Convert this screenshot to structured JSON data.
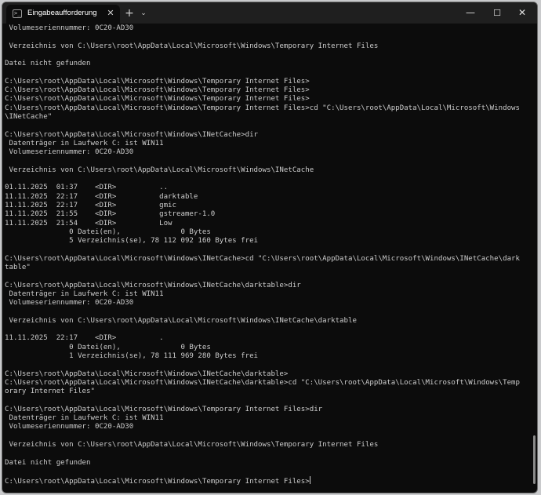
{
  "titlebar": {
    "tab_title": "Eingabeaufforderung",
    "tab_icon": "terminal-icon",
    "tab_close_glyph": "✕",
    "new_tab_glyph": "+",
    "dropdown_glyph": "⌄",
    "minimize_glyph": "—",
    "maximize_glyph": "☐",
    "close_glyph": "✕"
  },
  "console": {
    "lines": [
      " Volumeseriennummer: 0C20-AD30",
      "",
      " Verzeichnis von C:\\Users\\root\\AppData\\Local\\Microsoft\\Windows\\Temporary Internet Files",
      "",
      "Datei nicht gefunden",
      "",
      "C:\\Users\\root\\AppData\\Local\\Microsoft\\Windows\\Temporary Internet Files>",
      "C:\\Users\\root\\AppData\\Local\\Microsoft\\Windows\\Temporary Internet Files>",
      "C:\\Users\\root\\AppData\\Local\\Microsoft\\Windows\\Temporary Internet Files>",
      "C:\\Users\\root\\AppData\\Local\\Microsoft\\Windows\\Temporary Internet Files>cd \"C:\\Users\\root\\AppData\\Local\\Microsoft\\Windows",
      "\\INetCache\"",
      "",
      "C:\\Users\\root\\AppData\\Local\\Microsoft\\Windows\\INetCache>dir",
      " Datenträger in Laufwerk C: ist WIN11",
      " Volumeseriennummer: 0C20-AD30",
      "",
      " Verzeichnis von C:\\Users\\root\\AppData\\Local\\Microsoft\\Windows\\INetCache",
      "",
      "01.11.2025  01:37    <DIR>          ..",
      "11.11.2025  22:17    <DIR>          darktable",
      "11.11.2025  22:17    <DIR>          gmic",
      "11.11.2025  21:55    <DIR>          gstreamer-1.0",
      "11.11.2025  21:54    <DIR>          Low",
      "               0 Datei(en),              0 Bytes",
      "               5 Verzeichnis(se), 78 112 092 160 Bytes frei",
      "",
      "C:\\Users\\root\\AppData\\Local\\Microsoft\\Windows\\INetCache>cd \"C:\\Users\\root\\AppData\\Local\\Microsoft\\Windows\\INetCache\\dark",
      "table\"",
      "",
      "C:\\Users\\root\\AppData\\Local\\Microsoft\\Windows\\INetCache\\darktable>dir",
      " Datenträger in Laufwerk C: ist WIN11",
      " Volumeseriennummer: 0C20-AD30",
      "",
      " Verzeichnis von C:\\Users\\root\\AppData\\Local\\Microsoft\\Windows\\INetCache\\darktable",
      "",
      "11.11.2025  22:17    <DIR>          .",
      "               0 Datei(en),              0 Bytes",
      "               1 Verzeichnis(se), 78 111 969 280 Bytes frei",
      "",
      "C:\\Users\\root\\AppData\\Local\\Microsoft\\Windows\\INetCache\\darktable>",
      "C:\\Users\\root\\AppData\\Local\\Microsoft\\Windows\\INetCache\\darktable>cd \"C:\\Users\\root\\AppData\\Local\\Microsoft\\Windows\\Temp",
      "orary Internet Files\"",
      "",
      "C:\\Users\\root\\AppData\\Local\\Microsoft\\Windows\\Temporary Internet Files>dir",
      " Datenträger in Laufwerk C: ist WIN11",
      " Volumeseriennummer: 0C20-AD30",
      "",
      " Verzeichnis von C:\\Users\\root\\AppData\\Local\\Microsoft\\Windows\\Temporary Internet Files",
      "",
      "Datei nicht gefunden",
      ""
    ],
    "prompt": "C:\\Users\\root\\AppData\\Local\\Microsoft\\Windows\\Temporary Internet Files>"
  }
}
